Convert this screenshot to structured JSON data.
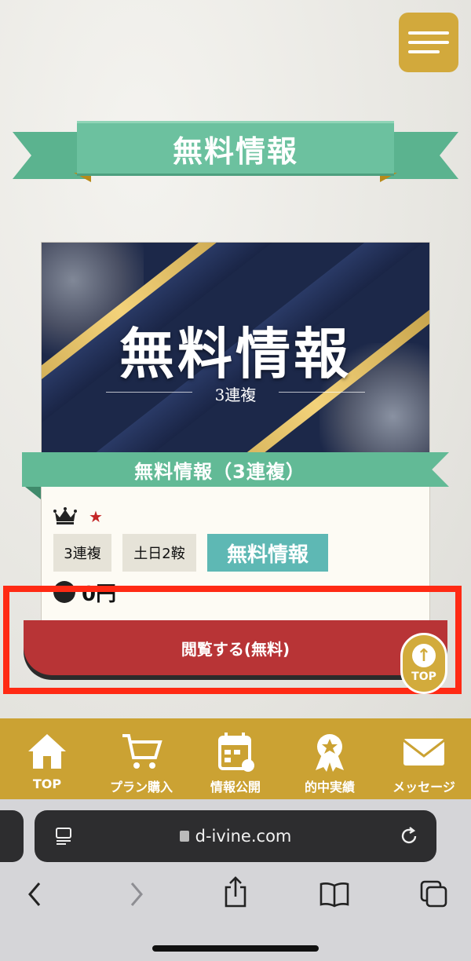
{
  "header": {
    "menu_button": "menu",
    "title": "無料情報"
  },
  "card": {
    "banner_title": "無料情報",
    "banner_subtitle": "3連複",
    "ribbon_title": "無料情報（3連複）",
    "tags": [
      "3連複",
      "土日2鞍",
      "無料情報"
    ],
    "price": "0円",
    "view_button": "閲覧する(無料)"
  },
  "float_top": {
    "label": "TOP"
  },
  "bottom_nav": {
    "items": [
      {
        "label": "TOP",
        "icon": "home-icon"
      },
      {
        "label": "プラン購入",
        "icon": "cart-icon"
      },
      {
        "label": "情報公開",
        "icon": "calendar-icon"
      },
      {
        "label": "的中実績",
        "icon": "medal-icon"
      },
      {
        "label": "メッセージ",
        "icon": "mail-icon"
      }
    ]
  },
  "browser": {
    "url": "d-ivine.com",
    "icons": [
      "reader-icon",
      "reload-icon",
      "back-icon",
      "forward-icon",
      "share-icon",
      "bookmarks-icon",
      "tabs-icon"
    ]
  },
  "colors": {
    "accent_gold": "#cba233",
    "ribbon_green": "#6cc19f",
    "button_red": "#b83436",
    "highlight_red": "#ff2a14"
  }
}
